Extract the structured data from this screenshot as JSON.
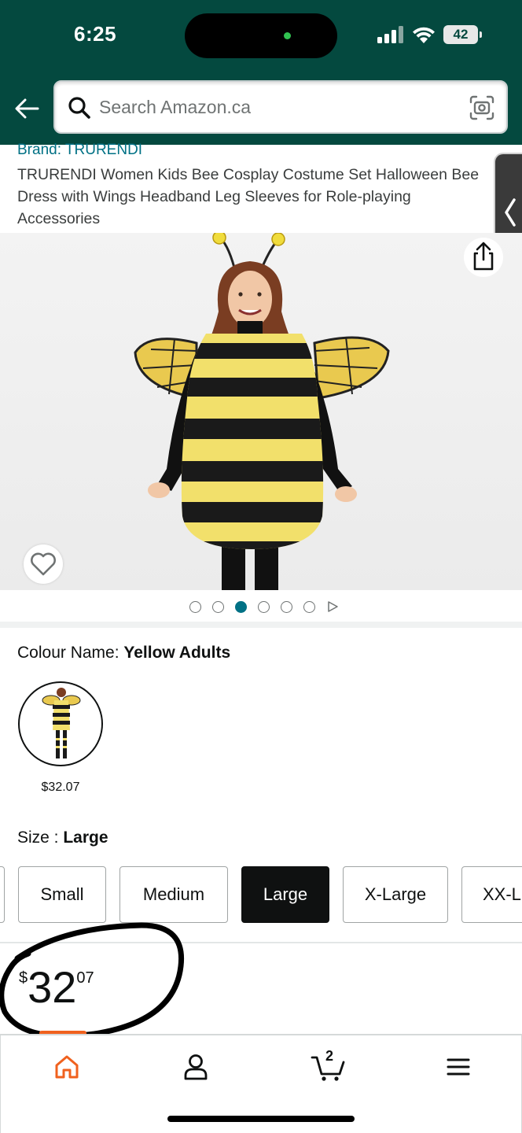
{
  "status_bar": {
    "time": "6:25",
    "battery": "42"
  },
  "search": {
    "placeholder": "Search Amazon.ca"
  },
  "product": {
    "brand": "Brand: TRURENDI",
    "title": "TRURENDI Women Kids Bee Cosplay Costume Set Halloween Bee Dress with Wings Headband Leg Sleeves for Role-playing Accessories",
    "image_count_dots": 6,
    "active_image_index": 2
  },
  "colour": {
    "label": "Colour Name: ",
    "value": "Yellow Adults",
    "swatch_price": "$32.07"
  },
  "size": {
    "label": "Size : ",
    "value": "Large",
    "options": [
      "Small",
      "Medium",
      "Large",
      "X-Large",
      "XX-L"
    ],
    "selected": "Large"
  },
  "price": {
    "symbol": "$",
    "whole": "32",
    "fraction": "07"
  },
  "bottom_nav": {
    "items": [
      "home-icon",
      "account-icon",
      "cart-icon",
      "menu-icon"
    ],
    "cart_count": "2"
  },
  "colors": {
    "header_bg": "#04493f",
    "link": "#007185",
    "home_active": "#f0611e"
  }
}
